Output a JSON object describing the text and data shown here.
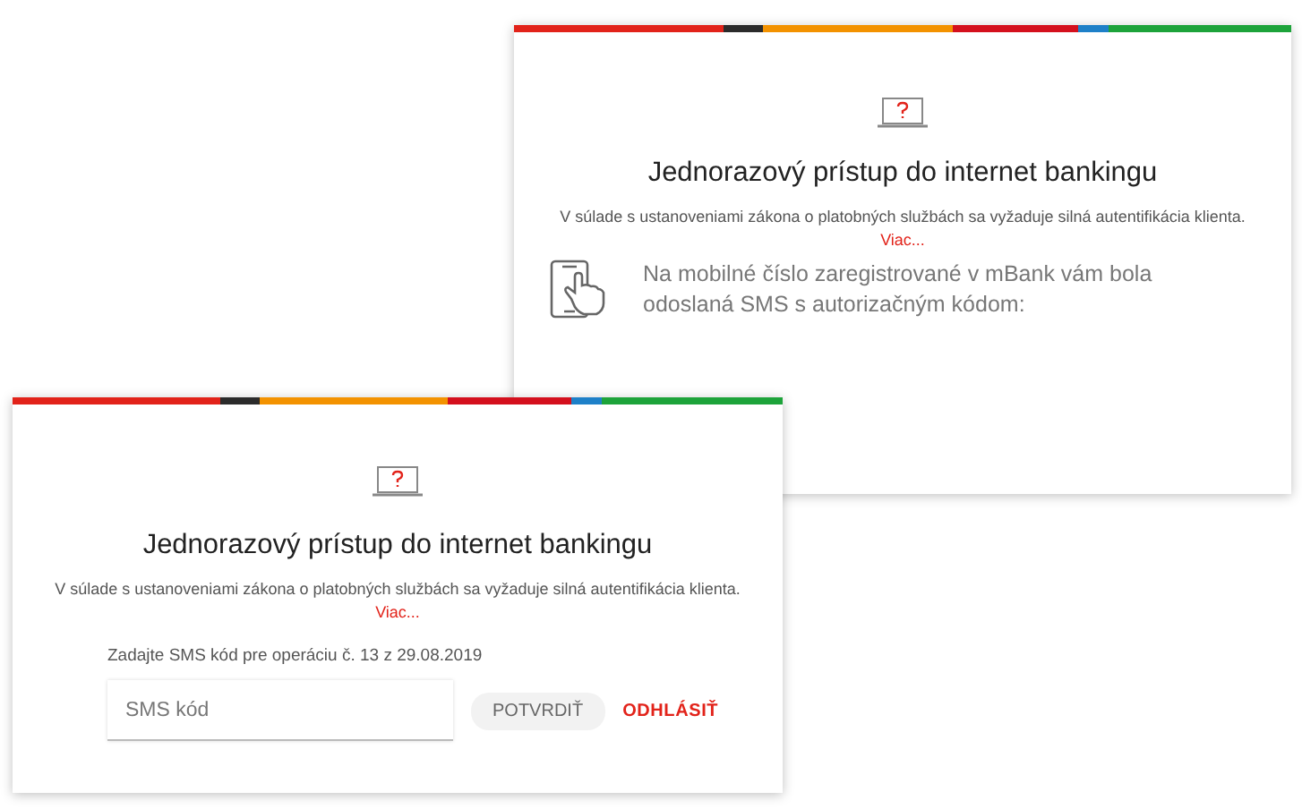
{
  "cards": [
    {
      "kind": "info",
      "title": "Jednorazový prístup do internet bankingu",
      "notice": "V súlade s ustanoveniami zákona o platobných službách sa vyžaduje silná autentifikácia klienta.",
      "more_link": "Viac...",
      "info_text": "Na mobilné číslo zaregistrované v mBank vám bola odoslaná SMS s autorizačným kódom:"
    },
    {
      "kind": "form",
      "title": "Jednorazový prístup do internet bankingu",
      "notice": "V súlade s ustanoveniami zákona o platobných službách sa vyžaduje silná autentifikácia klienta.",
      "more_link": "Viac...",
      "prompt": "Zadajte SMS kód pre operáciu č. 13 z  29.08.2019",
      "sms_field": {
        "placeholder": "SMS kód"
      },
      "confirm_button": "POTVRDIŤ",
      "logout_link": "ODHLÁSIŤ"
    }
  ]
}
